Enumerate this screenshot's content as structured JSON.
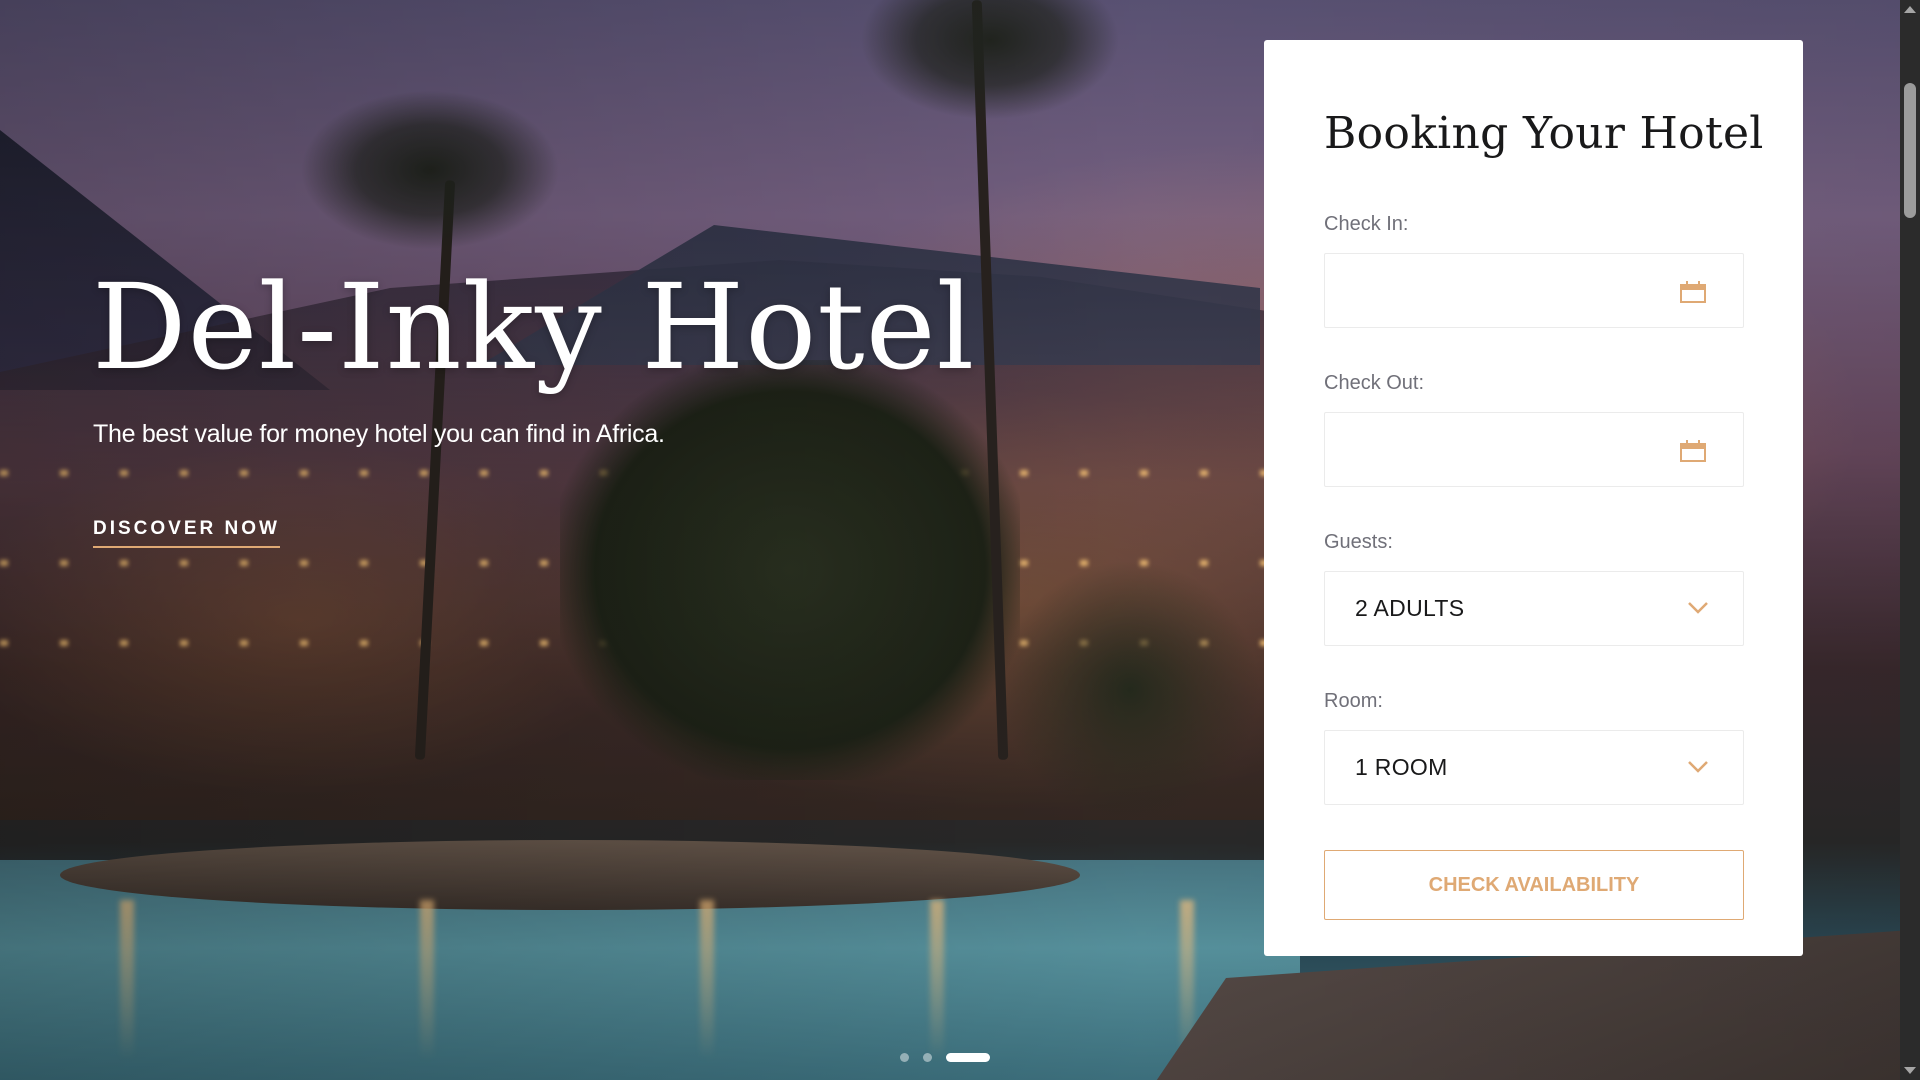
{
  "hero": {
    "title": "Del-Inky Hotel",
    "subtitle": "The best value for money hotel you can find in Africa.",
    "cta_label": "DISCOVER NOW"
  },
  "carousel": {
    "slide_count": 3,
    "active_index": 2
  },
  "booking": {
    "title": "Booking Your Hotel",
    "check_in": {
      "label": "Check In:",
      "value": ""
    },
    "check_out": {
      "label": "Check Out:",
      "value": ""
    },
    "guests": {
      "label": "Guests:",
      "selected": "2 ADULTS"
    },
    "room": {
      "label": "Room:",
      "selected": "1 ROOM"
    },
    "submit_label": "CHECK AVAILABILITY"
  },
  "colors": {
    "accent": "#dfa974",
    "heading": "#19191a",
    "label": "#707079",
    "border": "#ebebeb"
  },
  "icons": {
    "calendar": "calendar-icon",
    "chevron": "chevron-down-icon"
  }
}
